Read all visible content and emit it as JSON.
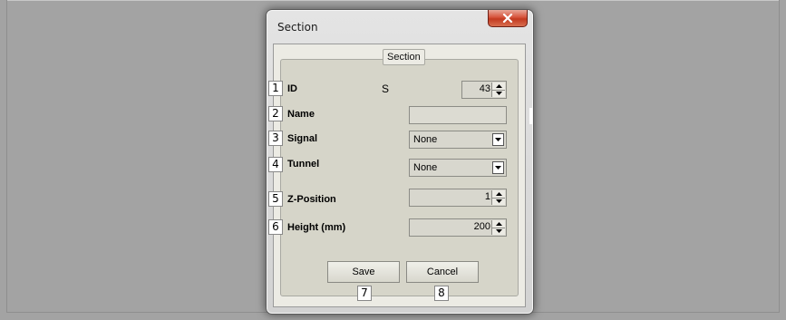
{
  "window": {
    "title": "Section",
    "close_icon": "close-icon"
  },
  "group": {
    "title": "Section"
  },
  "fields": [
    {
      "number": "1",
      "label": "ID",
      "static_value": "S",
      "value": "43",
      "type": "spinner"
    },
    {
      "number": "2",
      "label": "Name",
      "value": "",
      "type": "text"
    },
    {
      "number": "3",
      "label": "Signal",
      "value": "None",
      "type": "dropdown"
    },
    {
      "number": "4",
      "label": "Tunnel",
      "value": "None",
      "type": "dropdown"
    },
    {
      "number": "5",
      "label": "Z-Position",
      "value": "1",
      "type": "spinner"
    },
    {
      "number": "6",
      "label": "Height (mm)",
      "value": "200",
      "type": "spinner"
    }
  ],
  "buttons": {
    "save_label": "Save",
    "save_number": "7",
    "cancel_label": "Cancel",
    "cancel_number": "8"
  },
  "colors": {
    "close_button": "#c9462c",
    "background": "#a3a3a3"
  }
}
